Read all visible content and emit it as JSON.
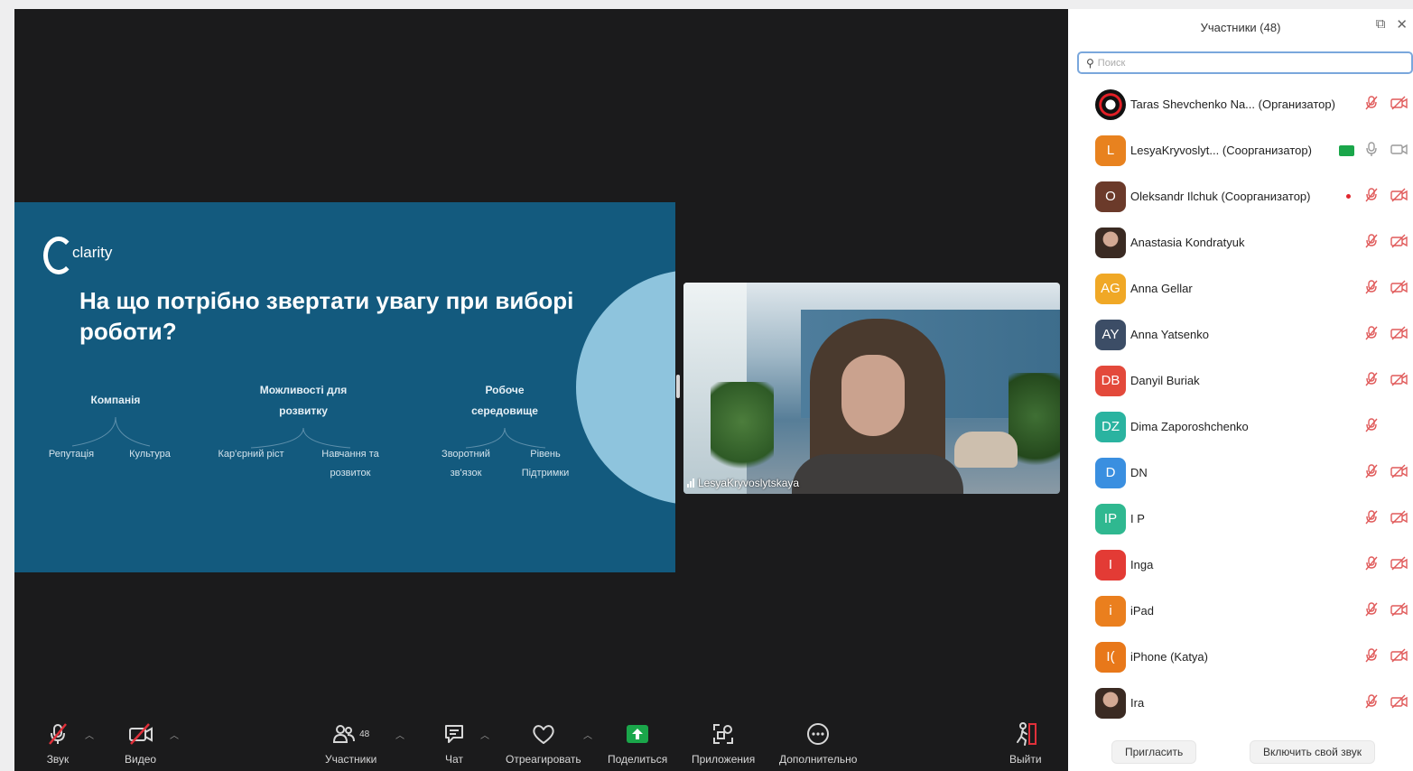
{
  "slide": {
    "logo_text": "clarity",
    "headline": "На що потрібно звертати увагу при виборі роботи?",
    "categories": [
      {
        "label": "Компанія",
        "children": [
          "Репутація",
          "Культура"
        ]
      },
      {
        "label": "Можливості для розвитку",
        "children": [
          "Кар'єрний ріст",
          "Навчання та розвиток"
        ]
      },
      {
        "label": "Робоче середовище",
        "children": [
          "Зворотний зв'язок",
          "Рівень Підтримки"
        ]
      }
    ]
  },
  "video": {
    "participant_name": "LesyaKryvoslytskaya"
  },
  "toolbar": {
    "audio_label": "Звук",
    "video_label": "Видео",
    "participants_label": "Участники",
    "participants_count": "48",
    "chat_label": "Чат",
    "react_label": "Отреагировать",
    "share_label": "Поделиться",
    "apps_label": "Приложения",
    "more_label": "Дополнительно",
    "leave_label": "Выйти"
  },
  "panel": {
    "title": "Участники (48)",
    "search_placeholder": "Поиск",
    "participants": [
      {
        "initials": "",
        "avatar": "mask",
        "color": "#000000",
        "name": "Taras Shevchenko Na...",
        "role": "(Организатор)",
        "mic": "off",
        "cam": "off"
      },
      {
        "initials": "L",
        "avatar": "letter",
        "color": "#e8821f",
        "name": "LesyaKryvoslyt...",
        "role": "(Соорганизатор)",
        "mic": "on",
        "cam": "on",
        "sharing": true
      },
      {
        "initials": "O",
        "avatar": "letter",
        "color": "#6b3a2a",
        "name": "Oleksandr Ilchuk",
        "role": "(Соорганизатор)",
        "mic": "off",
        "cam": "off",
        "recording": true
      },
      {
        "initials": "",
        "avatar": "photo",
        "color": "#3a2a22",
        "name": "Anastasia Kondratyuk",
        "role": "",
        "mic": "off",
        "cam": "off"
      },
      {
        "initials": "AG",
        "avatar": "letter",
        "color": "#f0a826",
        "name": "Anna Gellar",
        "role": "",
        "mic": "off",
        "cam": "off"
      },
      {
        "initials": "AY",
        "avatar": "letter",
        "color": "#3c4d66",
        "name": "Anna Yatsenko",
        "role": "",
        "mic": "off",
        "cam": "off"
      },
      {
        "initials": "DB",
        "avatar": "letter",
        "color": "#e3493b",
        "name": "Danyil Buriak",
        "role": "",
        "mic": "off",
        "cam": "off"
      },
      {
        "initials": "DZ",
        "avatar": "letter",
        "color": "#2ab3a0",
        "name": "Dima Zaporoshchenko",
        "role": "",
        "mic": "off",
        "cam": "none"
      },
      {
        "initials": "D",
        "avatar": "letter",
        "color": "#3a8fe0",
        "name": "DN",
        "role": "",
        "mic": "off",
        "cam": "off"
      },
      {
        "initials": "IP",
        "avatar": "letter",
        "color": "#2fb890",
        "name": "I P",
        "role": "",
        "mic": "off",
        "cam": "off"
      },
      {
        "initials": "I",
        "avatar": "letter",
        "color": "#e33b35",
        "name": "Inga",
        "role": "",
        "mic": "off",
        "cam": "off"
      },
      {
        "initials": "i",
        "avatar": "letter",
        "color": "#ea7f1e",
        "name": "iPad",
        "role": "",
        "mic": "off",
        "cam": "off"
      },
      {
        "initials": "I(",
        "avatar": "letter",
        "color": "#e8781a",
        "name": "iPhone (Katya)",
        "role": "",
        "mic": "off",
        "cam": "off"
      },
      {
        "initials": "",
        "avatar": "photo",
        "color": "#3a2a22",
        "name": "Ira",
        "role": "",
        "mic": "off",
        "cam": "off"
      }
    ],
    "invite_label": "Пригласить",
    "unmute_self_label": "Включить свой звук"
  },
  "colors": {
    "meeting_bg": "#1b1b1c",
    "slide_bg": "#135a7e",
    "accent_blue": "#7aa7dc",
    "muted_red": "#e05a5a",
    "share_green": "#1aa64a"
  }
}
